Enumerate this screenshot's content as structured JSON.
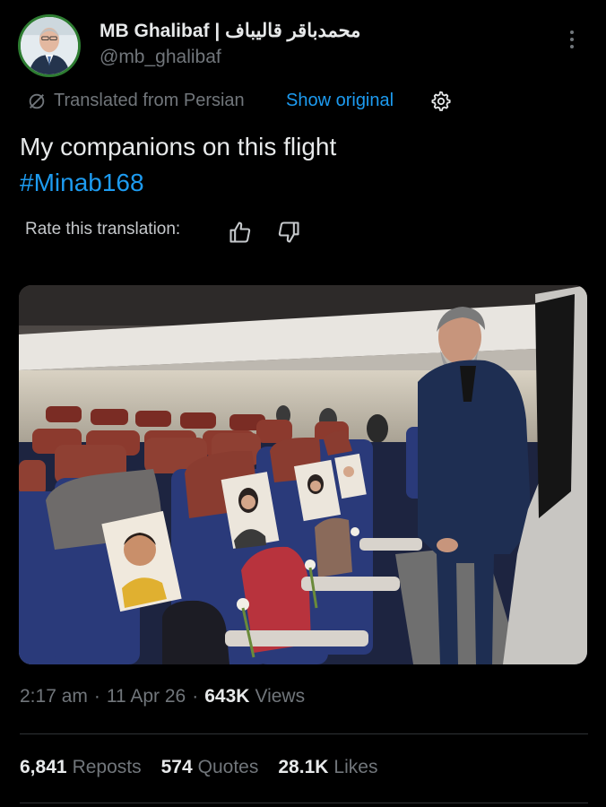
{
  "author": {
    "display_name": "MB Ghalibaf | محمدباقر قالیباف",
    "handle": "@mb_ghalibaf"
  },
  "translation_bar": {
    "icon": "translate-icon",
    "label": "Translated from Persian",
    "show_original": "Show original",
    "settings_icon": "gear-icon"
  },
  "tweet": {
    "text": "My companions on this flight",
    "hashtag": "#Minab168"
  },
  "rating": {
    "label": "Rate this translation:",
    "up_icon": "thumbs-up-icon",
    "down_icon": "thumbs-down-icon"
  },
  "meta": {
    "time": "2:17 am",
    "date": "11 Apr 26",
    "views_count": "643K",
    "views_label": "Views"
  },
  "stats": {
    "reposts_count": "6,841",
    "reposts_label": "Reposts",
    "quotes_count": "574",
    "quotes_label": "Quotes",
    "likes_count": "28.1K",
    "likes_label": "Likes"
  },
  "colors": {
    "background": "#000000",
    "text": "#e7e9ea",
    "muted": "#71767b",
    "accent": "#1d9bf0",
    "avatar_ring": "#2e7d32"
  }
}
